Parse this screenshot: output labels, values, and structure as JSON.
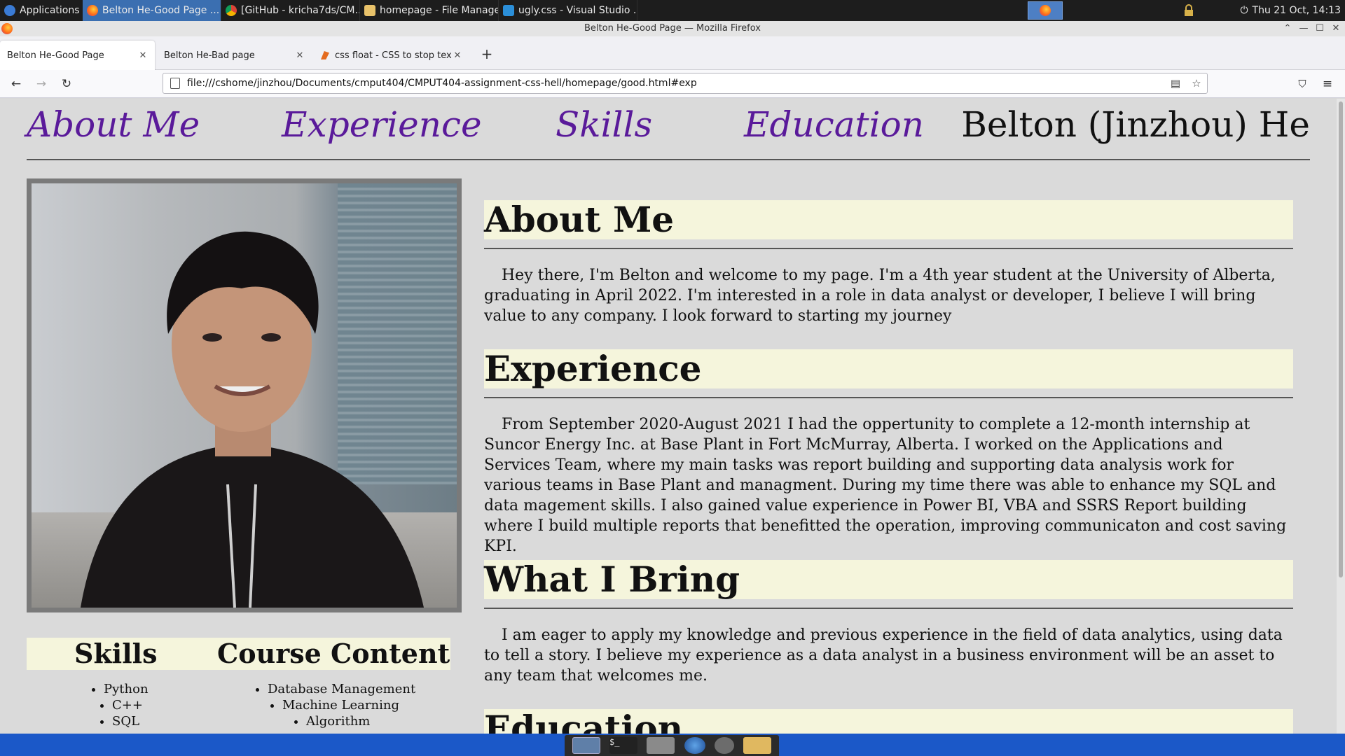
{
  "system_panel": {
    "applications_label": "Applications",
    "tasks": [
      "Belton He-Good Page ...",
      "[GitHub - kricha7ds/CM...",
      "homepage - File Manager",
      "ugly.css - Visual Studio ..."
    ],
    "clock": "Thu 21 Oct, 14:13"
  },
  "window": {
    "title": "Belton He-Good Page — Mozilla Firefox"
  },
  "browser": {
    "tabs": [
      {
        "label": "Belton He-Good Page"
      },
      {
        "label": "Belton He-Bad page"
      },
      {
        "label": "css float - CSS to stop tex"
      }
    ],
    "url": "file:///cshome/jinzhou/Documents/cmput404/CMPUT404-assignment-css-hell/homepage/good.html#exp"
  },
  "site": {
    "nav": [
      "About Me",
      "Experience",
      "Skills",
      "Education"
    ],
    "name": "Belton (Jinzhou) He",
    "sidebar": {
      "skills_heading": "Skills",
      "skills": [
        "Python",
        "C++",
        "SQL"
      ],
      "courses_heading": "Course Content",
      "courses": [
        "Database Management",
        "Machine Learning",
        "Algorithm"
      ]
    },
    "sections": [
      {
        "heading": "About Me",
        "text": "Hey there, I'm Belton and welcome to my page. I'm a 4th year student at the University of Alberta, graduating in April 2022. I'm interested in a role in data analyst or developer, I believe I will bring value to any company. I look forward to starting my journey"
      },
      {
        "heading": "Experience",
        "text": "From September 2020-August 2021 I had the oppertunity to complete a 12-month internship at Suncor Energy Inc. at Base Plant in Fort McMurray, Alberta. I worked on the Applications and Services Team, where my main tasks was report building and supporting data analysis work for various teams in Base Plant and managment. During my time there was able to enhance my SQL and data magement skills. I also gained value experience in Power BI, VBA and SSRS Report building where I build multiple reports that benefitted the operation, improving communicaton and cost saving KPI."
      },
      {
        "heading": "What I Bring",
        "text": "I am eager to apply my knowledge and previous experience in the field of data analytics, using data to tell a story. I believe my experience as a data analyst in a business environment will be an asset to any team that welcomes me."
      },
      {
        "heading": "Education",
        "text": ""
      }
    ]
  }
}
